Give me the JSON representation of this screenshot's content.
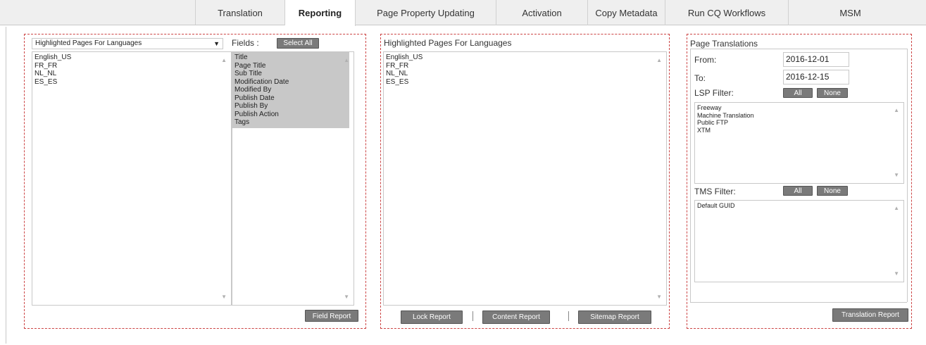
{
  "tabs": [
    {
      "label": "Translation",
      "active": false
    },
    {
      "label": "Reporting",
      "active": true
    },
    {
      "label": "Page Property Updating",
      "active": false
    },
    {
      "label": "Activation",
      "active": false
    },
    {
      "label": "Copy Metadata",
      "active": false
    },
    {
      "label": "Run CQ Workflows",
      "active": false
    },
    {
      "label": "MSM",
      "active": false
    }
  ],
  "left_panel": {
    "dropdown_value": "Highlighted Pages For Languages",
    "languages": [
      "English_US",
      "FR_FR",
      "NL_NL",
      "ES_ES"
    ],
    "fields_label": "Fields :",
    "select_all_label": "Select All",
    "fields": [
      "Title",
      "Page Title",
      "Sub Title",
      "Modification Date",
      "Modified By",
      "Publish Date",
      "Publish By",
      "Publish Action",
      "Tags"
    ],
    "field_report_label": "Field Report"
  },
  "middle_panel": {
    "title": "Highlighted Pages For Languages",
    "languages": [
      "English_US",
      "FR_FR",
      "NL_NL",
      "ES_ES"
    ],
    "lock_report_label": "Lock Report",
    "content_report_label": "Content Report",
    "sitemap_report_label": "Sitemap Report"
  },
  "right_panel": {
    "title": "Page Translations",
    "from_label": "From:",
    "from_value": "2016-12-01",
    "to_label": "To:",
    "to_value": "2016-12-15",
    "lsp_filter_label": "LSP Filter:",
    "lsp_all_label": "All",
    "lsp_none_label": "None",
    "lsp_items": [
      "Freeway",
      "Machine Translation",
      "Public FTP",
      "XTM"
    ],
    "tms_filter_label": "TMS Filter:",
    "tms_all_label": "All",
    "tms_none_label": "None",
    "tms_items": [
      "Default GUID"
    ],
    "translation_report_label": "Translation Report"
  },
  "colors": {
    "tab_bar_bg": "#efefef",
    "button_bg": "#7a7a7a",
    "panel_border": "#cc4444",
    "selected_field_bg": "#c8c8c8"
  },
  "icons": {
    "scroll_up": "▲",
    "scroll_down": "▼",
    "dropdown_arrow": "▼"
  }
}
